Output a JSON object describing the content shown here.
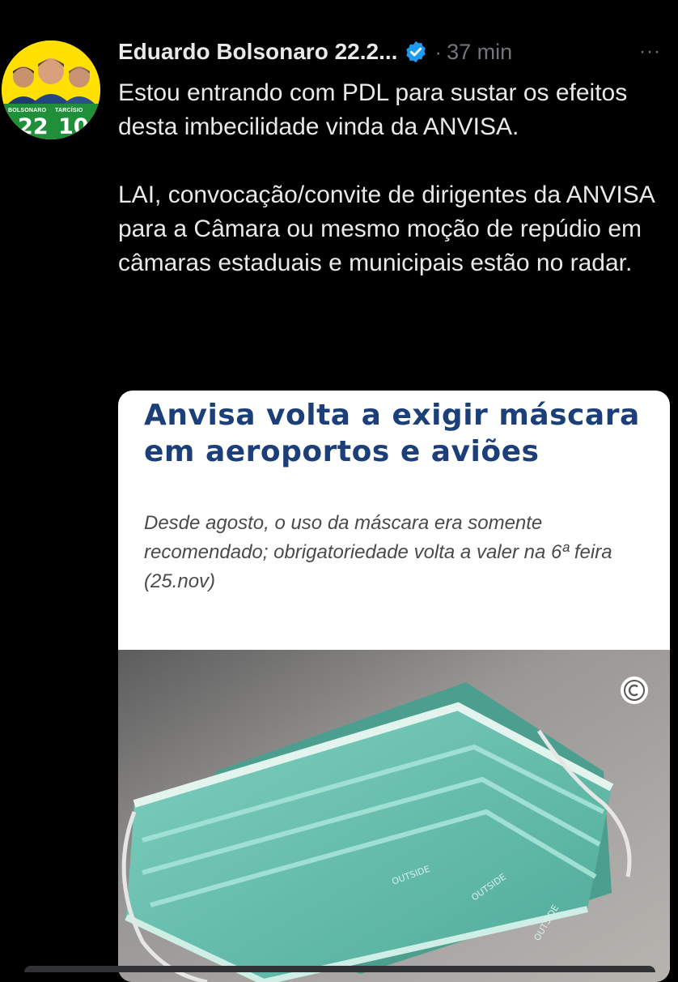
{
  "tweet": {
    "author_name": "Eduardo Bolsonaro 22.2...",
    "time": "37 min",
    "separator": "·",
    "more": "···",
    "paragraphs": [
      "Estou entrando com PDL para sustar os efeitos desta imbecilidade vinda da ANVISA.",
      "LAI, convocação/convite de dirigentes da ANVISA para a Câmara ou mesmo moção de repúdio em câmaras estaduais e municipais estão no radar."
    ]
  },
  "avatar": {
    "tag_left": "BOLSONARO",
    "tag_right": "TARCÍSIO",
    "num_left": "22",
    "num_right": "10"
  },
  "card": {
    "headline": "Anvisa volta a exigir máscara em aeroportos e aviões",
    "subtitle": "Desde agosto, o uso da máscara era somente recomendado; obrigatoriedade volta a valer na 6ª feira (25.nov)",
    "mask_print": "OUTSIDE"
  },
  "colors": {
    "background": "#000000",
    "text": "#e7e9ea",
    "muted": "#71767b",
    "verified": "#1d9bf0",
    "headline": "#1c3f7a",
    "mask": "#6ec4b3"
  },
  "icons": {
    "verified": "verified-badge-icon",
    "more": "more-icon",
    "copyright": "copyright-icon"
  }
}
